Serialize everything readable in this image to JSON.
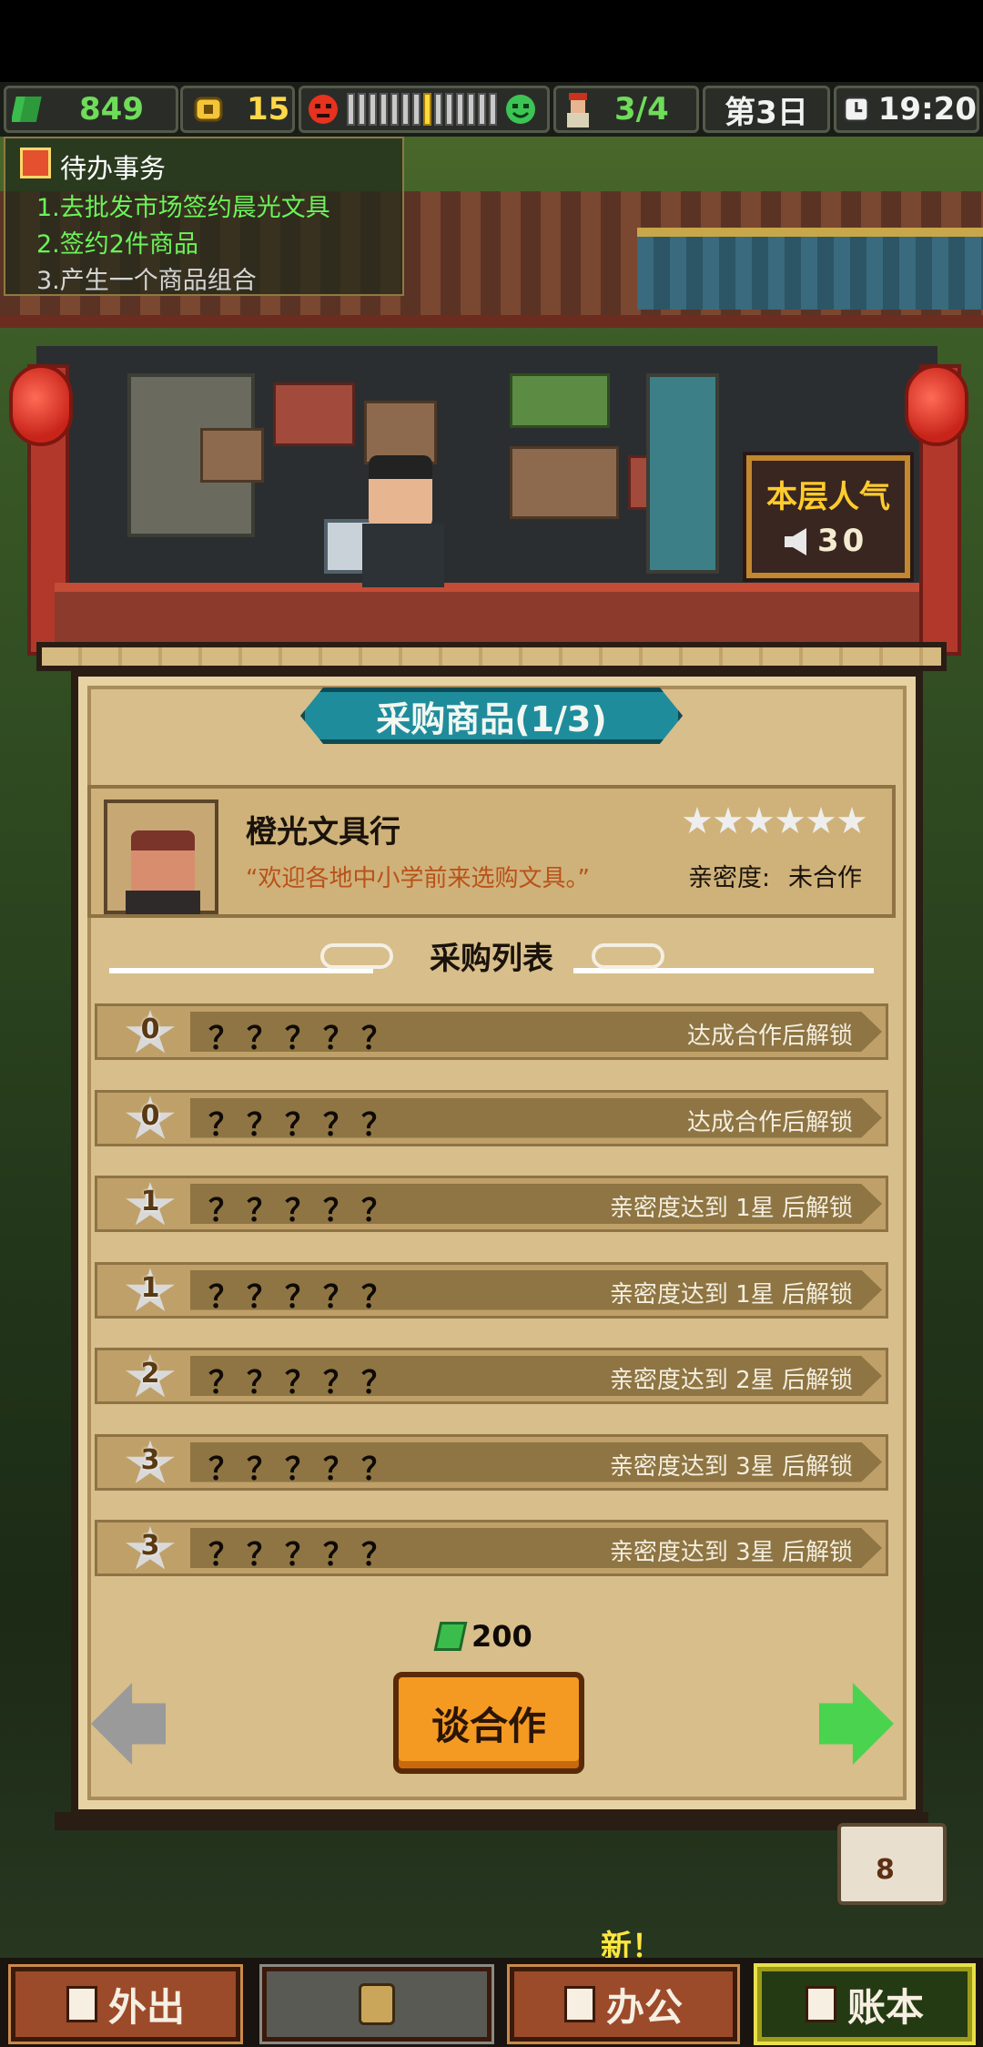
{
  "hud": {
    "money": "849",
    "coins": "15",
    "mood_level_fraction": 0.5,
    "staff": "3/4",
    "day": "第3日",
    "time": "19:20",
    "icons": [
      "money-icon",
      "coin-icon",
      "angry-face-icon",
      "happy-face-icon",
      "staff-icon",
      "clock-icon"
    ]
  },
  "todo": {
    "title": "待办事务",
    "items": [
      {
        "text": "1.去批发市场签约晨光文具",
        "status": "done"
      },
      {
        "text": "2.签约2件商品",
        "status": "done"
      },
      {
        "text": "3.产生一个商品组合",
        "status": "pending"
      }
    ]
  },
  "popularity": {
    "title": "本层人气",
    "value": "30"
  },
  "panel": {
    "title": "采购商品(1/3)",
    "vendor": {
      "name": "橙光文具行",
      "quote": "“欢迎各地中小学前来选购文具。”",
      "stars": 6,
      "affinity_label": "亲密度:",
      "affinity_value": "未合作"
    },
    "list_heading": "采购列表",
    "items": [
      {
        "level": "0",
        "name": "？？？？？",
        "condition": "达成合作后解锁"
      },
      {
        "level": "0",
        "name": "？？？？？",
        "condition": "达成合作后解锁"
      },
      {
        "level": "1",
        "name": "？？？？？",
        "condition": "亲密度达到 1星 后解锁"
      },
      {
        "level": "1",
        "name": "？？？？？",
        "condition": "亲密度达到 1星 后解锁"
      },
      {
        "level": "2",
        "name": "？？？？？",
        "condition": "亲密度达到 2星 后解锁"
      },
      {
        "level": "3",
        "name": "？？？？？",
        "condition": "亲密度达到 3星 后解锁"
      },
      {
        "level": "3",
        "name": "？？？？？",
        "condition": "亲密度达到 3星 后解锁"
      }
    ],
    "cost": "200",
    "negotiate_label": "谈合作"
  },
  "book_count": "8",
  "bottom": {
    "go_out": "外出",
    "office": "办公",
    "ledger": "账本",
    "new_label": "新！"
  },
  "colors": {
    "hud_green": "#6fdc5a",
    "gold": "#ffd84a",
    "panel_bg": "#d7be8a",
    "title_teal": "#1f8c9c",
    "button_orange": "#f49a22",
    "next_arrow_green": "#4ad34f"
  }
}
